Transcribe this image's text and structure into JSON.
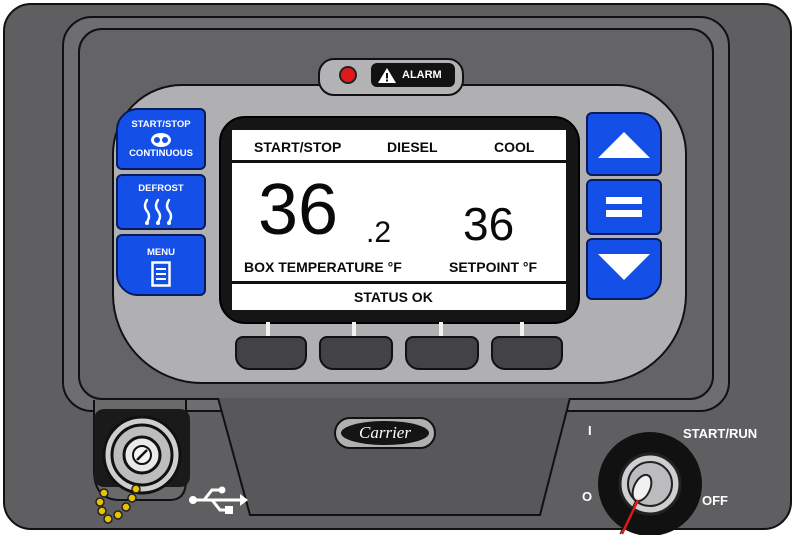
{
  "alarm": {
    "label": "ALARM",
    "led_color": "#e01a1a"
  },
  "left_keys": {
    "start_stop": {
      "top_label": "START/STOP",
      "bottom_label": "CONTINUOUS",
      "icon": "start-stop-icon"
    },
    "defrost": {
      "label": "DEFROST",
      "icon": "defrost-icon"
    },
    "menu": {
      "label": "MENU",
      "icon": "menu-icon"
    }
  },
  "right_keys": {
    "up": {
      "icon": "arrow-up-icon"
    },
    "enter": {
      "icon": "enter-icon"
    },
    "down": {
      "icon": "arrow-down-icon"
    }
  },
  "display": {
    "mode_start_stop": "START/STOP",
    "fuel": "DIESEL",
    "mode": "COOL",
    "box_temp_whole": "36",
    "box_temp_decimal": ".2",
    "box_temp_label": "BOX TEMPERATURE °F",
    "setpoint_value": "36",
    "setpoint_label": "SETPOINT °F",
    "status": "STATUS OK"
  },
  "soft_keys": [
    {
      "id": "soft-key-1"
    },
    {
      "id": "soft-key-2"
    },
    {
      "id": "soft-key-3"
    },
    {
      "id": "soft-key-4"
    }
  ],
  "brand": {
    "logo_text": "Carrier"
  },
  "usb": {
    "icon": "usb-icon"
  },
  "switch": {
    "on_label": "I",
    "start_run_label": "START/RUN",
    "off_position_label": "O",
    "off_label": "OFF"
  },
  "colors": {
    "housing": "#5f5f62",
    "bezel": "#b0b0b3",
    "blue_key": "#1450e8",
    "lcd_background": "#ffffff"
  }
}
